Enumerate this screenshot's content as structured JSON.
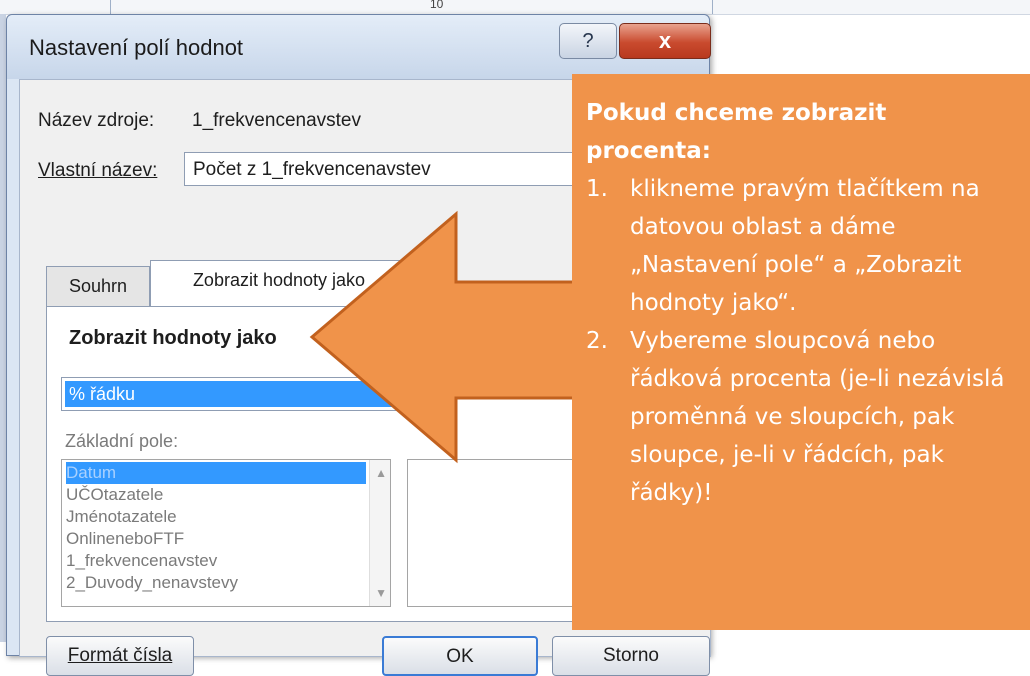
{
  "sheet": {
    "cell_text": "10"
  },
  "dialog": {
    "title": "Nastavení polí hodnot",
    "help_label": "?",
    "close_label": "x",
    "source_name_label": "Název zdroje:",
    "source_name_value": "1_frekvencenavstev",
    "custom_name_label": "Vlastní název:",
    "custom_name_value": "Počet z 1_frekvencenavstev",
    "tabs": [
      {
        "label": "Souhrn"
      },
      {
        "label": "Zobrazit hodnoty jako"
      }
    ],
    "panel": {
      "heading": "Zobrazit hodnoty jako",
      "show_as_value": "% řádku",
      "base_field_label": "Základní pole:",
      "base_fields": [
        "Datum",
        "UČOtazatele",
        "Jménotazatele",
        "OnlineneboFTF",
        "1_frekvencenavstev",
        "2_Duvody_nenavstevy"
      ],
      "selected_index": 0
    },
    "buttons": {
      "number_format": "Formát čísla",
      "ok": "OK",
      "cancel": "Storno"
    }
  },
  "callout": {
    "title": "Pokud chceme zobrazit procenta:",
    "items": [
      {
        "num": "1.",
        "text": "klikneme pravým tlačítkem na datovou oblast a dáme „Nastavení pole“ a „Zobrazit hodnoty jako“."
      },
      {
        "num": "2.",
        "text": "Vybereme sloupcová nebo řádková procenta (je-li nezávislá proměnná ve sloupcích, pak sloupce, je-li v řádcích, pak řádky)!"
      }
    ],
    "color": "#f0934a"
  },
  "arrow": {
    "color": "#f0934a",
    "stroke": "#c2611e"
  }
}
